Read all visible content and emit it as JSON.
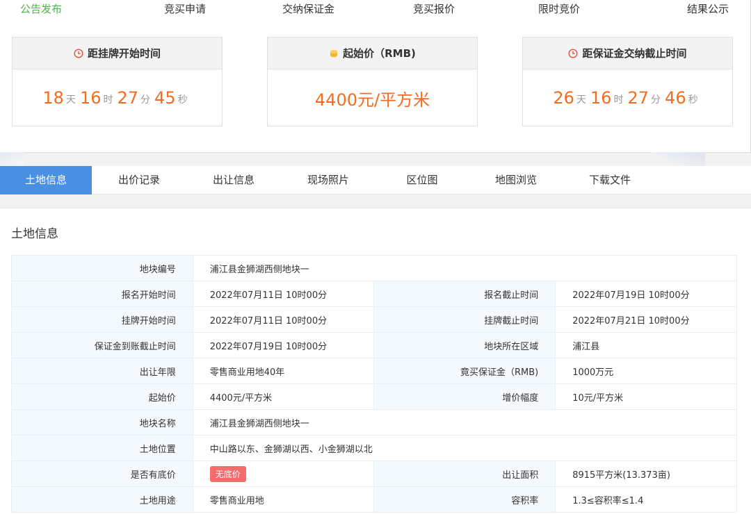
{
  "steps": [
    "公告发布",
    "竞买申请",
    "交纳保证金",
    "竞买报价",
    "限时竞价",
    "结果公示"
  ],
  "active_step": 0,
  "accent_color": "#52b152",
  "countdown_start": {
    "title": "距挂牌开始时间",
    "icon": "clock-icon",
    "days": "18",
    "days_unit": "天",
    "hours": "16",
    "hours_unit": "时",
    "minutes": "27",
    "minutes_unit": "分",
    "seconds": "45",
    "seconds_unit": "秒"
  },
  "start_price": {
    "title": "起始价（RMB)",
    "icon": "coin-icon",
    "value": "4400元/平方米"
  },
  "countdown_deposit": {
    "title": "距保证金交纳截止时间",
    "icon": "clock-icon",
    "days": "26",
    "days_unit": "天",
    "hours": "16",
    "hours_unit": "时",
    "minutes": "27",
    "minutes_unit": "分",
    "seconds": "46",
    "seconds_unit": "秒"
  },
  "tabs": [
    "土地信息",
    "出价记录",
    "出让信息",
    "现场照片",
    "区位图",
    "地图浏览",
    "下载文件"
  ],
  "active_tab": 0,
  "tab_active_color": "#4a90e2",
  "panel_title": "土地信息",
  "rows": [
    {
      "l1": "地块编号",
      "v1": "浦江县金狮湖西侧地块一"
    },
    {
      "l1": "报名开始时间",
      "v1": "2022年07月11日 10时00分",
      "l2": "报名截止时间",
      "v2": "2022年07月19日 10时00分"
    },
    {
      "l1": "挂牌开始时间",
      "v1": "2022年07月11日 10时00分",
      "l2": "挂牌截止时间",
      "v2": "2022年07月21日 10时00分"
    },
    {
      "l1": "保证金到账截止时间",
      "v1": "2022年07月19日 10时00分",
      "l2": "地块所在区域",
      "v2": "浦江县"
    },
    {
      "l1": "出让年限",
      "v1": "零售商业用地40年",
      "l2": "竟买保证金（RMB)",
      "v2": "1000万元"
    },
    {
      "l1": "起始价",
      "v1": "4400元/平方米",
      "l2": "增价幅度",
      "v2": "10元/平方米"
    },
    {
      "l1": "地块名称",
      "v1": "浦江县金狮湖西侧地块一"
    },
    {
      "l1": "土地位置",
      "v1": "中山路以东、金狮湖以西、小金狮湖以北"
    },
    {
      "l1": "是否有底价",
      "v1": "无底价",
      "l2": "出让面积",
      "v2": "8915平方米(13.373亩)"
    },
    {
      "l1": "土地用途",
      "v1": "零售商业用地",
      "l2": "容积率",
      "v2": "1.3≤容积率≤1.4"
    }
  ]
}
